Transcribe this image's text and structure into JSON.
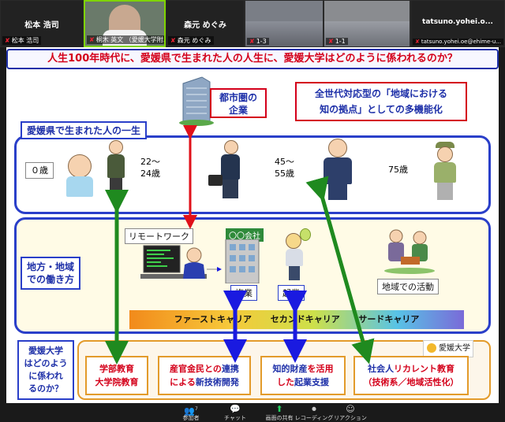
{
  "participants": [
    {
      "name": "松本 浩司",
      "label": "松本 浩司"
    },
    {
      "name": "桐木 英文 （愛媛大学附…",
      "label": "桐木 英文 （愛媛大学附…"
    },
    {
      "name": "森元 めぐみ",
      "label": "森元 めぐみ"
    },
    {
      "name": "1-3",
      "label": "1-3"
    },
    {
      "name": "1-1",
      "label": "1-1"
    },
    {
      "name": "tatsuno.yohei.o...",
      "label": "tatsuno.yohei.oe@ehime-u..."
    }
  ],
  "slide": {
    "title": "人生100年時代に、愛媛県で生まれた人の人生に、愛媛大学はどのように係われるのか？",
    "urban_company": [
      "都市圏の",
      "企業"
    ],
    "multifunction": [
      "全世代対応型の「地域における",
      "知の拠点」としての多機能化"
    ],
    "life_label": "愛媛県で生まれた人の一生",
    "ages": {
      "age0": "０歳",
      "age22": [
        "22～",
        "24歳"
      ],
      "age45": [
        "45～",
        "55歳"
      ],
      "age75": "75歳"
    },
    "work_label": [
      "地方・地域",
      "での働き方"
    ],
    "remote_work": "リモートワーク",
    "company_sign": "〇〇会社",
    "side_job": "複業",
    "startup": "起業",
    "community": "地域での活動",
    "career": [
      "ファーストキャリア",
      "セカンドキャリア",
      "サードキャリア"
    ],
    "ehime_question": [
      "愛媛大学",
      "はどのよう",
      "に係われ",
      "るのか？"
    ],
    "logo": "愛媛大学",
    "roles": [
      {
        "line1": "学部教育",
        "line2": "大学院教育"
      },
      {
        "line1a": "産官金民との",
        "line1b": "連携",
        "line2a": "による",
        "line2b": "新技術開発"
      },
      {
        "line1a": "知的財産",
        "line1b": "を活用",
        "line2a": "した",
        "line2b": "起業支援"
      },
      {
        "line1a": "社会人",
        "line1b": "リカレント教育",
        "line2": "（技術系／地域活性化）"
      }
    ]
  },
  "toolbar": [
    {
      "icon": "participants-icon",
      "glyph": "👥",
      "label": "参加者",
      "count": "7"
    },
    {
      "icon": "chat-icon",
      "glyph": "💬",
      "label": "チャット"
    },
    {
      "icon": "share-screen-icon",
      "glyph": "⬆",
      "label": "画面の共有"
    },
    {
      "icon": "record-icon",
      "glyph": "⏺",
      "label": "レコーディング"
    },
    {
      "icon": "reaction-icon",
      "glyph": "☺",
      "label": "リアクション"
    }
  ]
}
